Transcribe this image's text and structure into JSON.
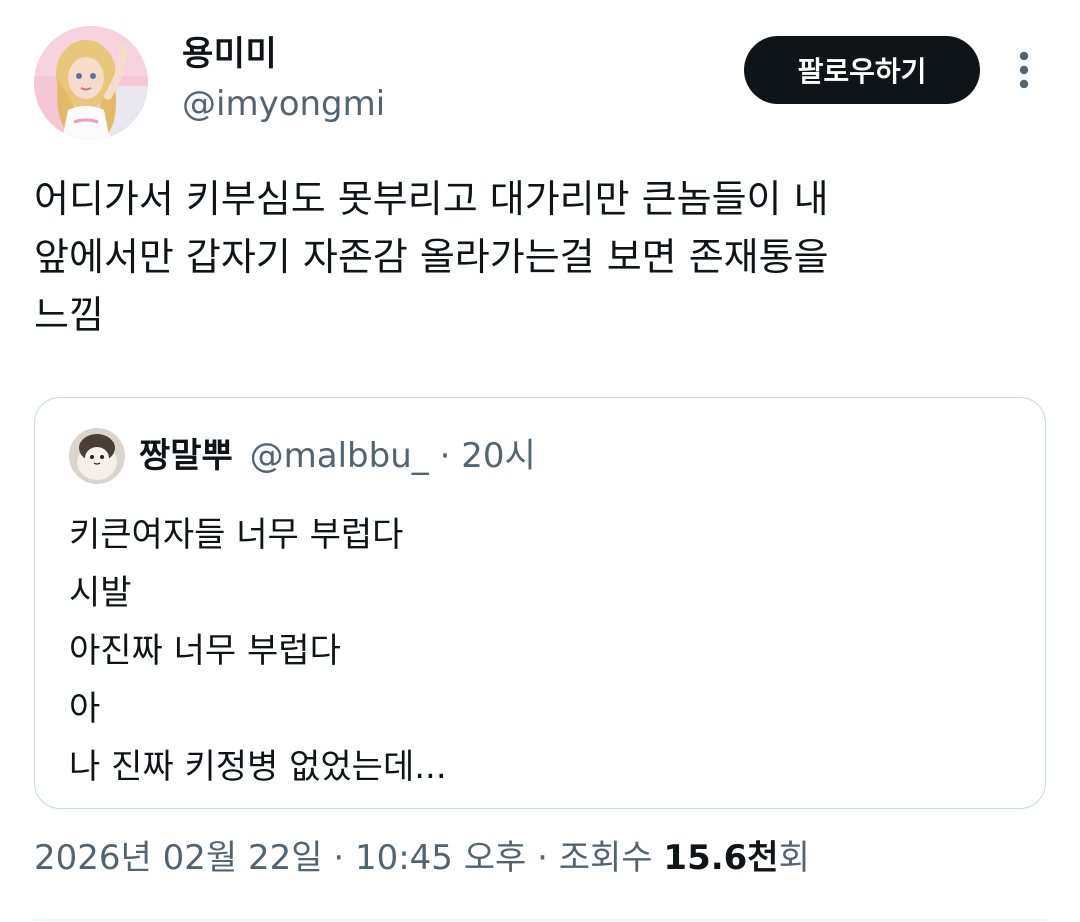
{
  "author": {
    "name": "용미미",
    "handle": "@imyongmi"
  },
  "actions": {
    "follow_label": "팔로우하기"
  },
  "tweet": {
    "lines": [
      "어디가서 키부심도 못부리고 대가리만 큰놈들이 내",
      "앞에서만 갑자기 자존감 올라가는걸 보면 존재통을",
      "느낌"
    ]
  },
  "quote": {
    "name": "짱말뿌",
    "handle": "@malbbu_",
    "separator": " · ",
    "time": "20시",
    "lines": [
      "키큰여자들 너무 부럽다",
      "시발",
      "아진짜 너무 부럽다",
      "아",
      "나 진짜 키정병 없었는데..."
    ]
  },
  "footer": {
    "date": "2026년 02월 22일",
    "separator": " · ",
    "time": "10:45 오후",
    "views_label": "조회수 ",
    "views_count": "15.6천",
    "views_suffix": "회"
  },
  "icons": {
    "more": "more-vertical-icon"
  },
  "colors": {
    "text_primary": "#0f1419",
    "text_secondary": "#536471",
    "border": "#cfd9de",
    "button_bg": "#0f1419"
  }
}
